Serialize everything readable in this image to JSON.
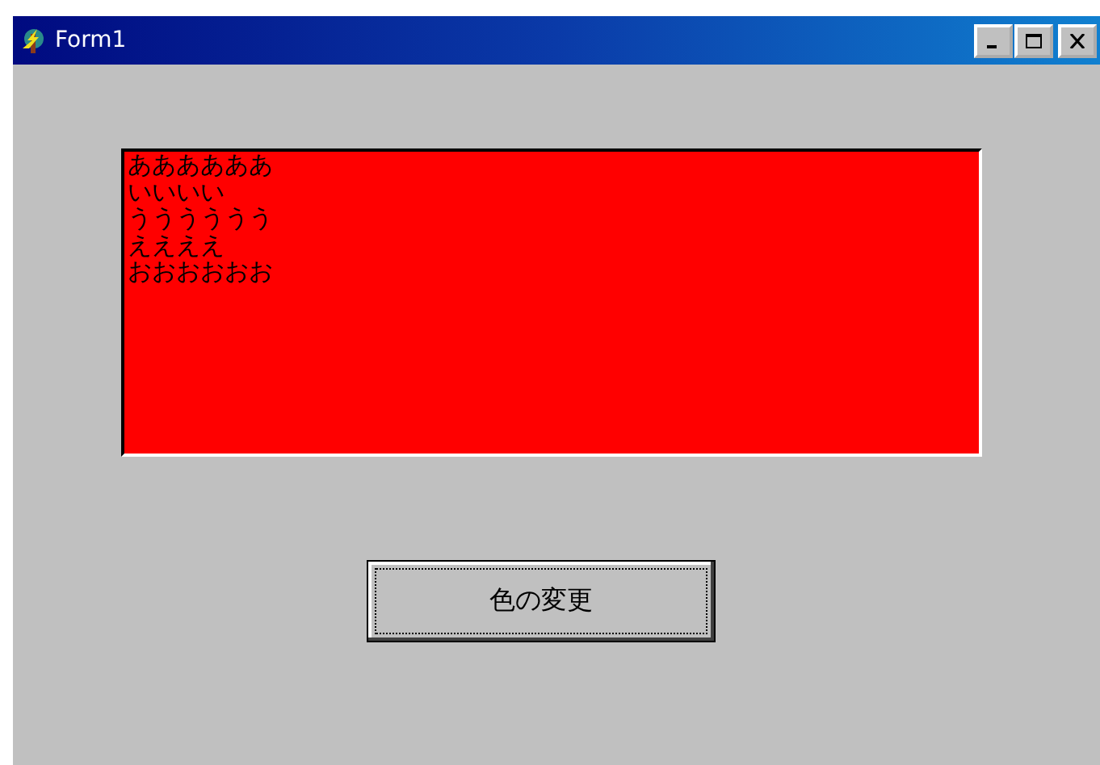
{
  "window": {
    "title": "Form1",
    "controls": [
      {
        "kind": "minimize"
      },
      {
        "kind": "maximize"
      },
      {
        "kind": "close"
      }
    ]
  },
  "textbox": {
    "lines": [
      "ああああああ",
      "いいいい",
      "うううううう",
      "ええええ",
      "おおおおおお"
    ]
  },
  "button": {
    "label": "色の変更"
  }
}
